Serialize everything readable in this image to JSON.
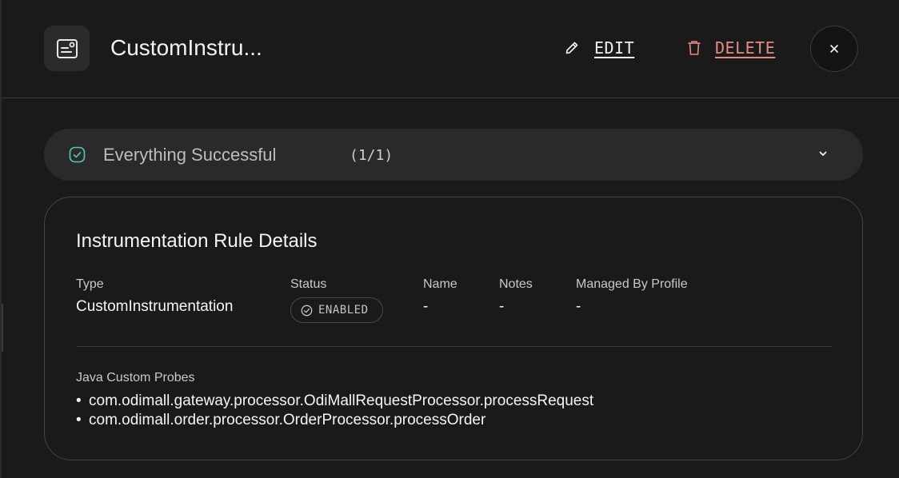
{
  "header": {
    "title": "CustomInstru...",
    "icon": "rule-icon",
    "edit_label": "EDIT",
    "delete_label": "DELETE",
    "close_label": "×"
  },
  "status_banner": {
    "text": "Everything Successful",
    "count": "(1/1)",
    "icon": "check-circle-icon",
    "accent": "#52c9b8"
  },
  "details": {
    "title": "Instrumentation Rule Details",
    "fields": [
      {
        "label": "Type",
        "value": "CustomInstrumentation"
      },
      {
        "label": "Status",
        "value": "ENABLED"
      },
      {
        "label": "Name",
        "value": "-"
      },
      {
        "label": "Notes",
        "value": "-"
      },
      {
        "label": "Managed By Profile",
        "value": "-"
      }
    ],
    "probes_label": "Java Custom Probes",
    "probes": [
      "com.odimall.gateway.processor.OdiMallRequestProcessor.processRequest",
      "com.odimall.order.processor.OrderProcessor.processOrder"
    ]
  },
  "colors": {
    "background": "#1a1a1a",
    "surface": "#2a2a2a",
    "danger": "#e68b84",
    "success": "#52c9b8"
  }
}
